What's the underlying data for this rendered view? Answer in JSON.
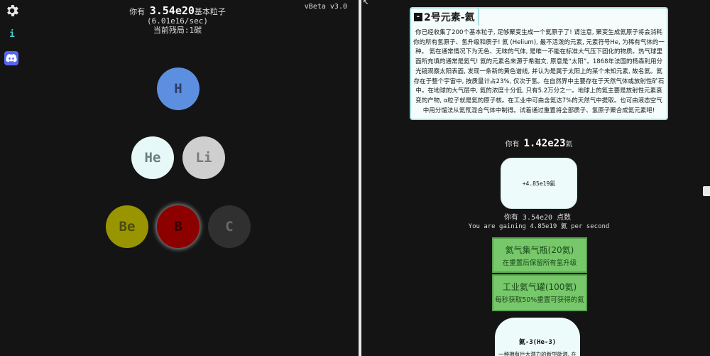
{
  "left": {
    "icons": {
      "settings": "gear-icon",
      "info": "info-icon",
      "discord": "discord-icon"
    },
    "info_glyph": "i",
    "stats": {
      "prefix": "你有",
      "amount": "3.54e20",
      "unit": "基本粒子",
      "rate": "(6.01e16/sec)",
      "round": "当前残局:1碳"
    },
    "version": "vBeta v3.0",
    "elements": [
      {
        "symbol": "H",
        "color": "#5d8fe0"
      },
      {
        "symbol": "He",
        "color": "#e6f8f8"
      },
      {
        "symbol": "Li",
        "color": "#cfcfcf"
      },
      {
        "symbol": "Be",
        "color": "#999500"
      },
      {
        "symbol": "B",
        "color": "#8c0000"
      },
      {
        "symbol": "C",
        "color": "#303030"
      }
    ]
  },
  "right": {
    "title": "2号元素-氦",
    "collapse_glyph": "-",
    "description": "你已经收集了200个基本粒子, 足够聚变生成一个氦原子了! 请注意, 聚变生成氦原子将会消耗你的所有氢原子、氢升级和质子! 氦 (Helium), 最不活泼的元素, 元素符号He, 为稀有气体的一种。 氦在通常情况下为无色、无味的气体, 是唯一不能在标准大气压下固化的物质。热气球里面所充填的通常是氦气! 氦的元素名来源于希腊文, 原意是“太阳”。1868年法国的杨森利用分光镜观察太阳表面, 发现一条新的黄色谱线, 并认为是属于太阳上的某个未知元素, 故名氦。氦存在于整个宇宙中, 按质量计占23%, 仅次于氢。在自然界中主要存在于天然气体或放射性矿石中。在地球的大气层中, 氦的浓度十分低, 只有5.2万分之一。地球上的氦主要是放射性元素衰变的产物, α粒子就是氦的原子核。在工业中可由含氦达7%的天然气中提取。也可由液态空气中用分馏法从氦氖混合气体中制得。试着通过重置将全部质子、氢原子聚合成氦元素吧!",
    "have": {
      "prefix": "你有",
      "amount": "1.42e23",
      "unit": "氦"
    },
    "gain_button": "+4.85e19氦",
    "points_line": "你有 3.54e20 点数",
    "gain_line": "You are gaining 4.85e19 氦 per second",
    "upgrades": [
      {
        "title": "氦气集气瓶(20氦)",
        "desc": "在重置后保留所有氢升级"
      },
      {
        "title": "工业氦气罐(100氦)",
        "desc": "每秒获取50%重置可获得的氦"
      }
    ],
    "next_card": {
      "title": "氦-3(He-3)",
      "desc": "一种拥有巨大潜力的新型能源, 在"
    },
    "colors": {
      "upgrade_bg": "#77c76b",
      "card_bg": "#eefbfb",
      "title_border": "#a6e0e0"
    }
  }
}
